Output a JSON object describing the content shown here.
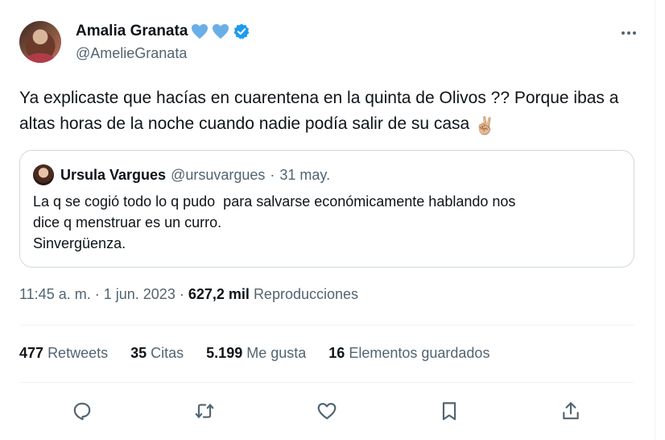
{
  "author": {
    "display_name": "Amalia Granata",
    "handle": "@AmelieGranata",
    "heart_color": "#6aaee8",
    "verified_color": "#1d9bf0",
    "icons": [
      "blue-heart-icon",
      "blue-heart-icon",
      "verified-badge-icon"
    ]
  },
  "tweet": {
    "text": "Ya explicaste que hacías en cuarentena en la quinta de Olivos ?? Porque ibas a altas horas de la noche cuando nadie podía salir de su casa",
    "emoji": "✌🏼"
  },
  "quoted": {
    "name": "Ursula Vargues",
    "handle": "@ursuvargues",
    "separator": "·",
    "date": "31 may.",
    "lines": [
      "La q se cogió todo lo q pudo  para salvarse económicamente hablando nos",
      "dice q menstruar es un curro.",
      "Sinvergüenza."
    ]
  },
  "meta": {
    "time": "11:45 a. m.",
    "separator": "·",
    "date": "1 jun. 2023",
    "views_count": "627,2 mil",
    "views_label": "Reproducciones"
  },
  "stats": [
    {
      "count": "477",
      "label": "Retweets"
    },
    {
      "count": "35",
      "label": "Citas"
    },
    {
      "count": "5.199",
      "label": "Me gusta"
    },
    {
      "count": "16",
      "label": "Elementos guardados"
    }
  ],
  "actions": [
    "reply-icon",
    "retweet-icon",
    "like-icon",
    "bookmark-icon",
    "share-icon"
  ],
  "colors": {
    "text": "#0f1419",
    "secondary": "#536471",
    "border": "#cfd9de",
    "divider": "#eff3f4"
  }
}
